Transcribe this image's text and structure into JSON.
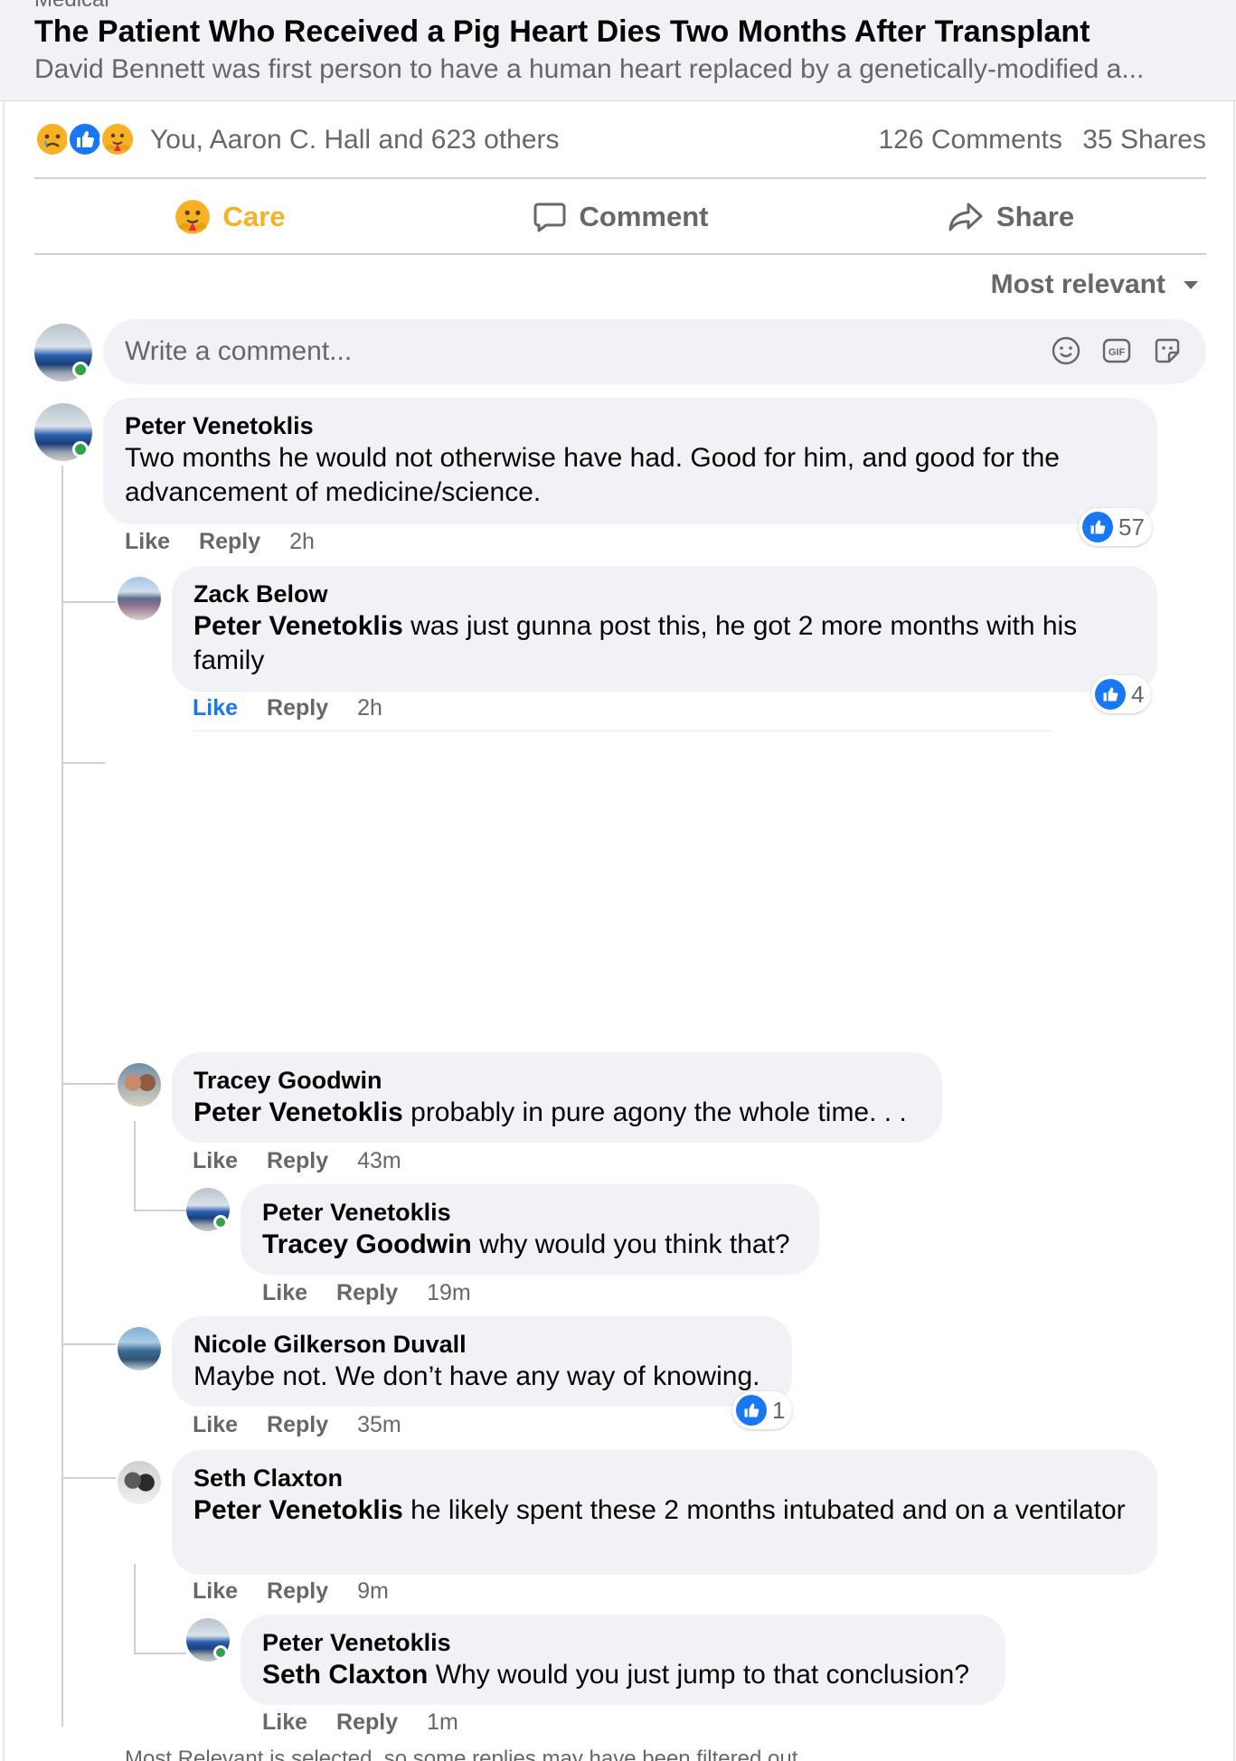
{
  "preview": {
    "cut_text": "Medical",
    "title": "The Patient Who Received a Pig Heart Dies Two Months After Transplant",
    "subtitle": "David Bennett was first person to have a human heart replaced by a genetically-modified a..."
  },
  "reactions": {
    "summary": "You, Aaron C. Hall and 623 others",
    "comments": "126 Comments",
    "shares": "35 Shares",
    "icons": [
      "sad-icon",
      "like-icon",
      "care-icon"
    ]
  },
  "actions": {
    "care": "Care",
    "comment": "Comment",
    "share": "Share"
  },
  "sort": {
    "label": "Most relevant"
  },
  "composer": {
    "placeholder": "Write a comment..."
  },
  "comments": [
    {
      "name": "Peter Venetoklis",
      "mention": "",
      "text": "Two months he would not otherwise have had. Good for him, and good for the advancement of medicine/science.",
      "like": "Like",
      "reply": "Reply",
      "time": "2h",
      "likes": "57"
    },
    {
      "name": "Zack Below",
      "mention": "Peter Venetoklis",
      "text": " was just gunna post this, he got 2 more months with his family",
      "like": "Like",
      "reply": "Reply",
      "time": "2h",
      "likes": "4"
    },
    {
      "name": "Tracey Goodwin",
      "mention": "Peter Venetoklis",
      "text": " probably in pure agony the whole time. . .",
      "like": "Like",
      "reply": "Reply",
      "time": "43m"
    },
    {
      "name": "Peter Venetoklis",
      "mention": "Tracey Goodwin",
      "text": " why would you think that?",
      "like": "Like",
      "reply": "Reply",
      "time": "19m"
    },
    {
      "name": "Nicole Gilkerson Duvall",
      "mention": "",
      "text": "Maybe not. We don’t have any way of knowing.",
      "like": "Like",
      "reply": "Reply",
      "time": "35m",
      "likes": "1"
    },
    {
      "name": "Seth Claxton",
      "mention": "Peter Venetoklis",
      "text": " he likely spent these 2 months intubated and on a ventilator",
      "like": "Like",
      "reply": "Reply",
      "time": "9m"
    },
    {
      "name": "Peter Venetoklis",
      "mention": "Seth Claxton",
      "text": " Why would you just jump to that conclusion?",
      "like": "Like",
      "reply": "Reply",
      "time": "1m"
    }
  ],
  "footer_note": "Most Relevant is selected, so some replies may have been filtered out.",
  "colors": {
    "accent": "#1877f2",
    "care": "#f7b125",
    "muted": "#65676b",
    "bubble": "#f0f2f5",
    "online": "#31a24c"
  }
}
